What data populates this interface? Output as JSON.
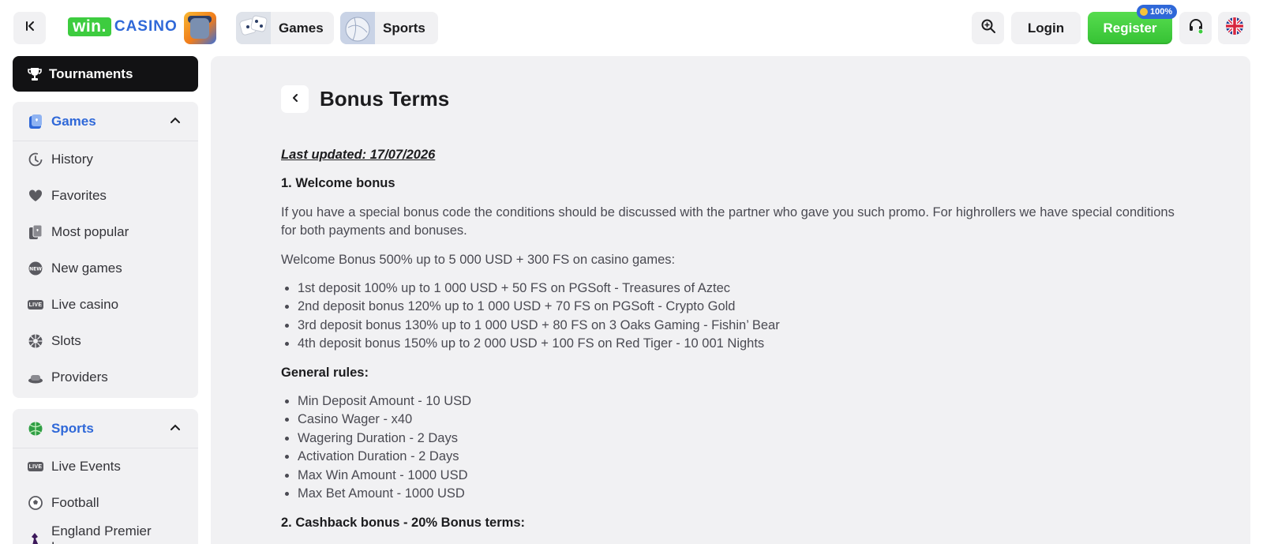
{
  "header": {
    "logo": {
      "win": "win.",
      "casino": "CASINO"
    },
    "nav": [
      {
        "label": "Games"
      },
      {
        "label": "Sports"
      }
    ],
    "login_label": "Login",
    "register_label": "Register",
    "register_badge": "100%",
    "icons": {
      "collapse": "collapse-sidebar-icon",
      "search": "search-icon",
      "support": "headset-icon",
      "language": "uk-flag-icon"
    },
    "colors": {
      "register": "#3dcc3f",
      "brand_blue": "#2f68d8"
    }
  },
  "sidebar": {
    "tournaments_label": "Tournaments",
    "games": {
      "title": "Games",
      "items": [
        {
          "label": "History",
          "icon": "history-icon"
        },
        {
          "label": "Favorites",
          "icon": "heart-icon"
        },
        {
          "label": "Most popular",
          "icon": "cards-icon"
        },
        {
          "label": "New games",
          "icon": "new-icon"
        },
        {
          "label": "Live casino",
          "icon": "live-icon"
        },
        {
          "label": "Slots",
          "icon": "slots-icon"
        },
        {
          "label": "Providers",
          "icon": "providers-icon"
        }
      ]
    },
    "sports": {
      "title": "Sports",
      "items": [
        {
          "label": "Live Events",
          "icon": "live-icon"
        },
        {
          "label": "Football",
          "icon": "football-icon"
        },
        {
          "label": "England Premier League",
          "icon": "premier-league-icon"
        }
      ]
    }
  },
  "main": {
    "title": "Bonus Terms",
    "last_updated": "Last updated: 17/07/2026",
    "section1_heading": "1. Welcome bonus",
    "section1_intro": "If you have a special bonus code the conditions should be discussed with the partner who gave you such promo. For highrollers we have special conditions for both payments and bonuses.",
    "welcome_summary": "Welcome Bonus 500% up to 5 000 USD + 300 FS on casino games:",
    "deposits": [
      "1st deposit 100% up to 1 000 USD + 50 FS on PGSoft - Treasures of Aztec",
      "2nd deposit bonus 120% up to 1 000 USD + 70 FS on PGSoft - Crypto Gold",
      "3rd deposit bonus 130% up to 1 000 USD + 80 FS on 3 Oaks Gaming - Fishin’ Bear",
      "4th deposit bonus 150% up to 2 000 USD + 100 FS on Red Tiger - 10 001 Nights"
    ],
    "general_rules_heading": "General rules:",
    "rules": [
      "Min Deposit Amount - 10 USD",
      "Casino Wager - x40",
      "Wagering Duration - 2 Days",
      "Activation Duration - 2 Days",
      "Max Win Amount - 1000 USD",
      "Max Bet Amount - 1000 USD"
    ],
    "section2_heading": "2. Cashback bonus - 20% Bonus terms:"
  }
}
